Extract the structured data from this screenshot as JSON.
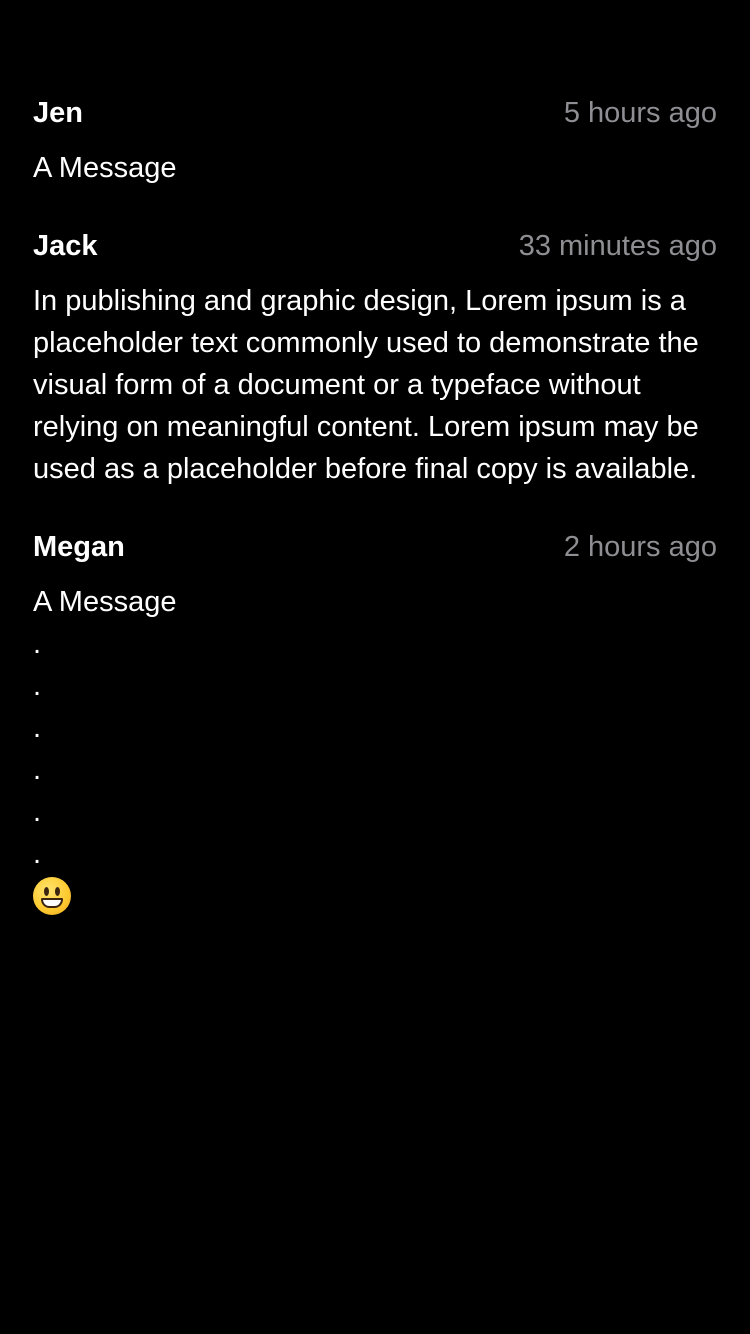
{
  "messages": [
    {
      "author": "Jen",
      "time": "5 hours ago",
      "text": "A Message"
    },
    {
      "author": "Jack",
      "time": "33 minutes ago",
      "text": "In publishing and graphic design, Lorem ipsum is a placeholder text commonly used to demonstrate the visual form of a document or a typeface without relying on meaningful content. Lorem ipsum may be used as a placeholder before final copy is available."
    },
    {
      "author": "Megan",
      "time": "2 hours ago",
      "text": "A Message\n.\n.\n.\n.\n.\n.",
      "emoji": "grinning-face-emoji"
    }
  ],
  "colors": {
    "background": "#000000",
    "text": "#ffffff",
    "timestamp": "#8e8e93"
  }
}
